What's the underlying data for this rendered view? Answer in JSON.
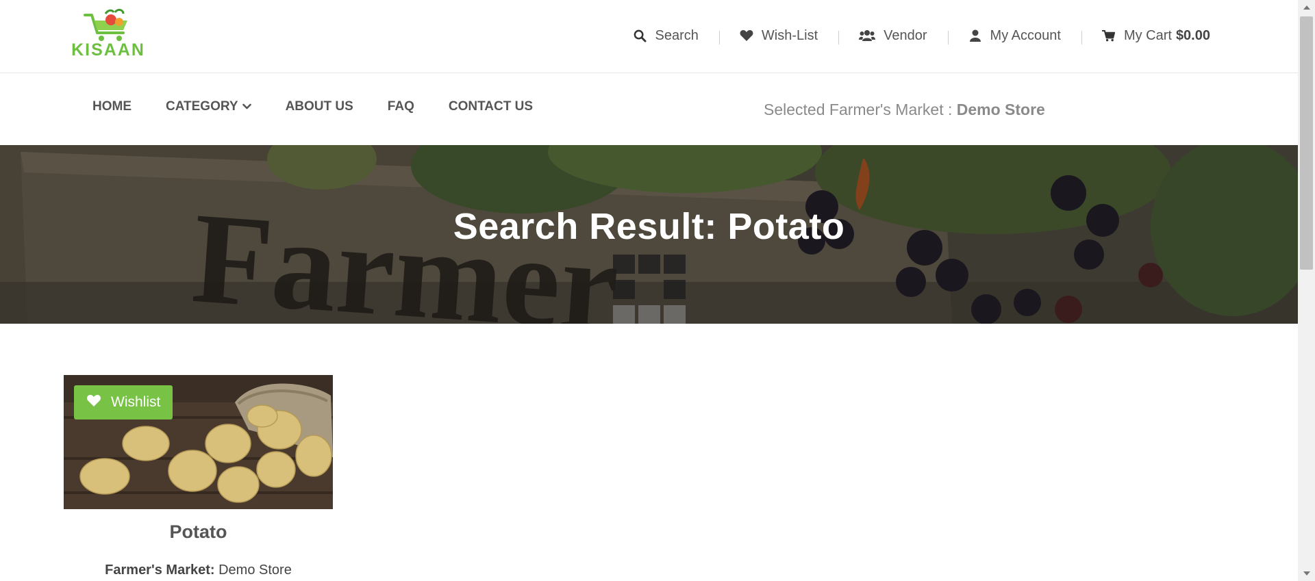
{
  "brand": {
    "name": "KISAAN"
  },
  "toplinks": [
    {
      "label": "Search",
      "icon": "search-icon"
    },
    {
      "label": "Wish-List",
      "icon": "heart-icon"
    },
    {
      "label": "Vendor",
      "icon": "users-icon"
    },
    {
      "label": "My Account",
      "icon": "user-icon"
    },
    {
      "label": "My Cart",
      "icon": "cart-icon",
      "total": "$0.00"
    }
  ],
  "nav": {
    "items": [
      "HOME",
      "CATEGORY",
      "ABOUT US",
      "FAQ",
      "CONTACT US"
    ],
    "market_label": "Selected Farmer's Market :",
    "market_value": "Demo Store"
  },
  "banner": {
    "title": "Search Result: Potato"
  },
  "product": {
    "wishlist_label": "Wishlist",
    "name": "Potato",
    "market_label": "Farmer's Market:",
    "market_value": "Demo Store"
  },
  "colors": {
    "accent": "#78c245",
    "brand": "#6cbf3f",
    "text": "#555555"
  }
}
